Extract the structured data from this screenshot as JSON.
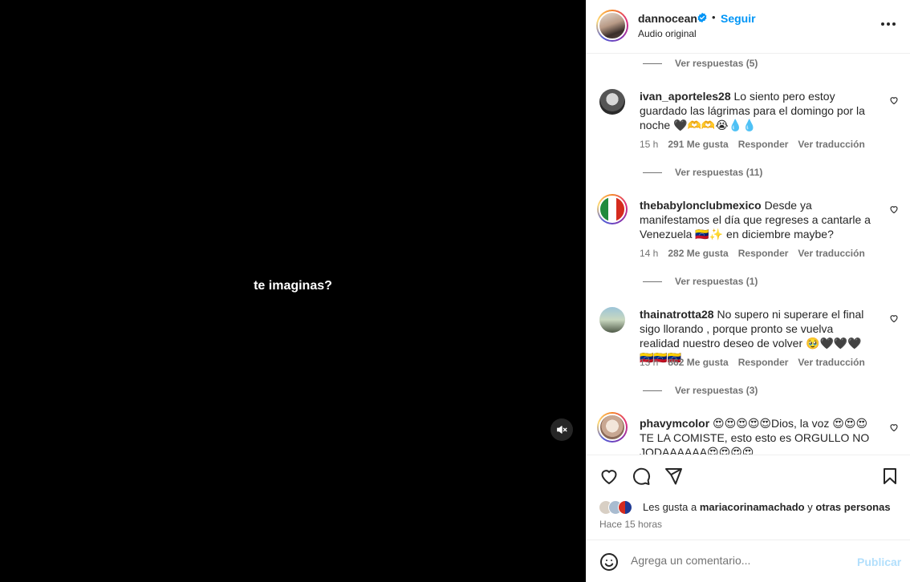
{
  "video": {
    "overlay_text": "te imaginas?",
    "mute_icon": "muted-speaker-icon"
  },
  "header": {
    "username": "dannocean",
    "verified_icon": "verified-badge-icon",
    "separator": "•",
    "follow_label": "Seguir",
    "subtitle": "Audio original",
    "more_icon": "more-options-icon"
  },
  "comments": {
    "top_replies": "Ver respuestas (5)",
    "items": [
      {
        "user": "ivan_aporteles28",
        "text": "Lo siento pero estoy guardado las lágrimas para el domingo por la noche 🖤🫶🫶😭💧💧",
        "time": "15 h",
        "likes": "291 Me gusta",
        "reply": "Responder",
        "translate": "Ver traducción",
        "replies": "Ver respuestas (11)"
      },
      {
        "user": "thebabylonclubmexico",
        "text": "Desde ya manifestamos el día que regreses a cantarle a Venezuela 🇻🇪✨ en diciembre maybe?",
        "time": "14 h",
        "likes": "282 Me gusta",
        "reply": "Responder",
        "translate": "Ver traducción",
        "replies": "Ver respuestas (1)"
      },
      {
        "user": "thainatrotta28",
        "text": "No supero ni superare el final sigo llorando , porque pronto se vuelva realidad nuestro deseo de volver 🥹🖤🖤🖤🇻🇪🇻🇪🇻🇪",
        "time": "13 h",
        "likes": "862 Me gusta",
        "reply": "Responder",
        "translate": "Ver traducción",
        "replies": "Ver respuestas (3)"
      },
      {
        "user": "phavymcolor",
        "text": "😍😍😍😍😍Dios, la voz 😍😍😍 TE LA COMISTE, esto esto es ORGULLO NO JODAAAAAA😍😍😍😍"
      }
    ]
  },
  "actions": {
    "like_icon": "heart-icon",
    "comment_icon": "comment-bubble-icon",
    "share_icon": "paper-plane-icon",
    "save_icon": "bookmark-icon",
    "likes_prefix": "Les gusta a",
    "likes_user": "mariacorinamachado",
    "likes_and": "y",
    "likes_others": "otras personas",
    "time_ago": "Hace 15 horas"
  },
  "add_comment": {
    "emoji_icon": "emoji-smiley-icon",
    "placeholder": "Agrega un comentario...",
    "publish_label": "Publicar"
  },
  "colors": {
    "link_blue": "#0095f6",
    "publish_disabled": "#b2dffc",
    "muted_text": "#737373"
  }
}
